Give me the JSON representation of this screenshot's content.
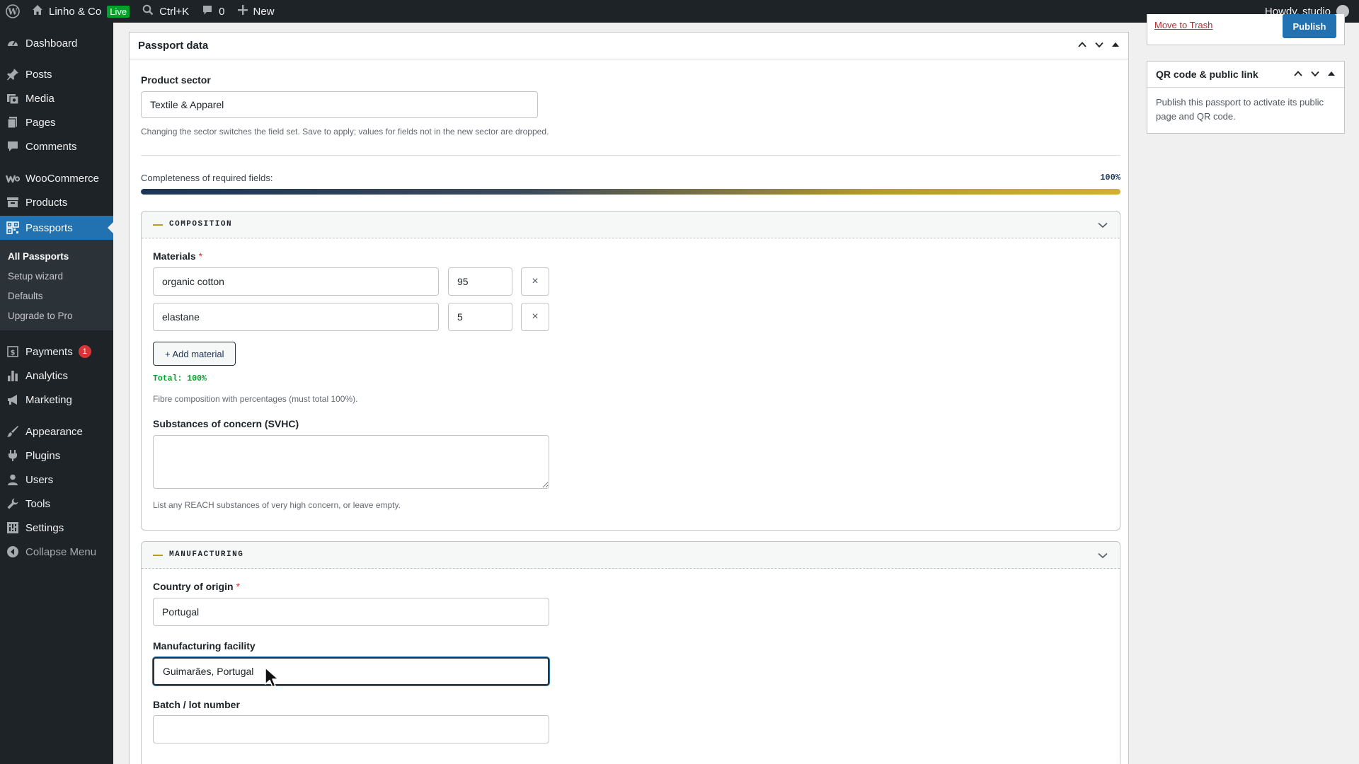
{
  "adminbar": {
    "site_name": "Linho & Co",
    "live_badge": "Live",
    "search_shortcut": "Ctrl+K",
    "comments_count": "0",
    "new_label": "New",
    "howdy": "Howdy, studio"
  },
  "sidebar": {
    "dashboard": "Dashboard",
    "posts": "Posts",
    "media": "Media",
    "pages": "Pages",
    "comments": "Comments",
    "woocommerce": "WooCommerce",
    "products": "Products",
    "passports": "Passports",
    "submenu": {
      "all_passports": "All Passports",
      "setup_wizard": "Setup wizard",
      "defaults": "Defaults",
      "upgrade": "Upgrade to Pro"
    },
    "payments": "Payments",
    "payments_badge": "1",
    "analytics": "Analytics",
    "marketing": "Marketing",
    "appearance": "Appearance",
    "plugins": "Plugins",
    "users": "Users",
    "tools": "Tools",
    "settings": "Settings",
    "collapse": "Collapse Menu"
  },
  "passport": {
    "title": "Passport data",
    "sector_label": "Product sector",
    "sector_value": "Textile & Apparel",
    "sector_help": "Changing the sector switches the field set. Save to apply; values for fields not in the new sector are dropped.",
    "completeness_label": "Completeness of required fields:",
    "completeness_value": "100%",
    "completeness_fraction": 1.0,
    "composition": {
      "title": "COMPOSITION",
      "materials_label": "Materials",
      "required_mark": "*",
      "materials": [
        {
          "name": "organic cotton",
          "percent": "95"
        },
        {
          "name": "elastane",
          "percent": "5"
        }
      ],
      "remove_symbol": "×",
      "add_label": "+ Add material",
      "total": "Total: 100%",
      "materials_help": "Fibre composition with percentages (must total 100%).",
      "svhc_label": "Substances of concern (SVHC)",
      "svhc_value": "",
      "svhc_help": "List any REACH substances of very high concern, or leave empty."
    },
    "manufacturing": {
      "title": "MANUFACTURING",
      "country_label": "Country of origin",
      "required_mark": "*",
      "country_value": "Portugal",
      "facility_label": "Manufacturing facility",
      "facility_value": "Guimarães, Portugal",
      "batch_label": "Batch / lot number",
      "batch_value": ""
    }
  },
  "publish_box": {
    "trash_link": "Move to Trash",
    "publish_label": "Publish"
  },
  "qr_box": {
    "title": "QR code & public link",
    "text": "Publish this passport to activate its public page and QR code."
  },
  "colors": {
    "accent": "#2271b1",
    "sidebar_bg": "#1d2327",
    "gold": "#b59a2e",
    "success": "#00a32a",
    "danger": "#d63638"
  }
}
